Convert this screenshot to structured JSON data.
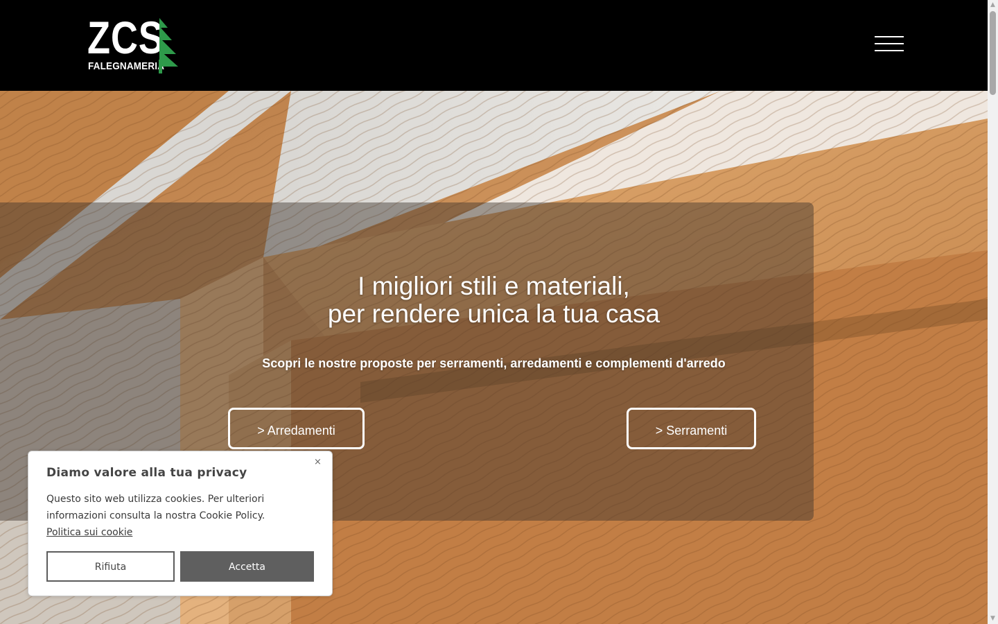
{
  "header": {
    "logo": {
      "mark": "ZCS",
      "subtitle": "FALEGNAMERIA",
      "tree_icon": "tree-icon"
    },
    "menu_icon": "hamburger-menu-icon"
  },
  "hero": {
    "title_line1": "I migliori stili e materiali,",
    "title_line2": "per rendere unica la tua casa",
    "subtitle": "Scopri le nostre proposte per serramenti, arredamenti e complementi d'arredo",
    "buttons": {
      "arredamenti": "> Arredamenti",
      "serramenti": "> Serramenti"
    }
  },
  "cookie_banner": {
    "title": "Diamo valore alla tua privacy",
    "close_symbol": "×",
    "text": "Questo sito web utilizza cookies. Per ulteriori informazioni consulta la nostra Cookie Policy. ",
    "link": "Politica sui cookie",
    "reject_label": "Rifiuta",
    "accept_label": "Accetta"
  },
  "scrollbar": {
    "up_arrow": "▲",
    "down_arrow": "▼"
  },
  "colors": {
    "header_bg": "#000000",
    "logo_green": "#2e9a4a",
    "wood": "#c98c55",
    "accept_bg": "#5f5f5f"
  }
}
